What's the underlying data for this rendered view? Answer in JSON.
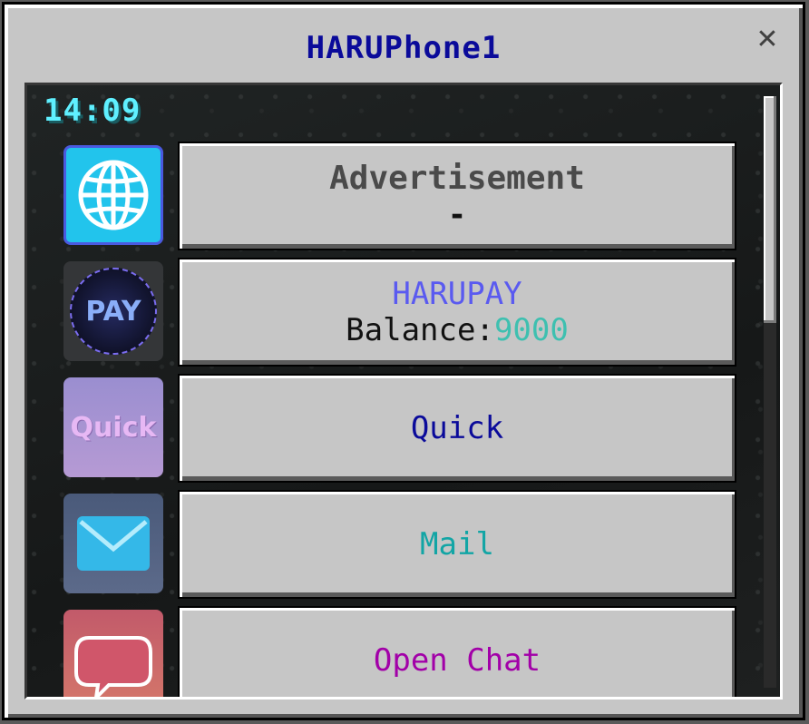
{
  "window": {
    "title": "HARUPhone1",
    "close_symbol": "✕",
    "colors": {
      "title": "#0a0a9a",
      "frame": "#c6c6c6"
    }
  },
  "screen": {
    "clock": "14:09"
  },
  "apps": [
    {
      "id": "advertisement",
      "icon": "globe-icon",
      "title": "Advertisement",
      "subtitle": "-",
      "title_color": "#4a4a4a",
      "tile_color": "#22c4ec"
    },
    {
      "id": "harupay",
      "icon": "pay-icon",
      "icon_text": "PAY",
      "title": "HARUPAY",
      "balance_label": "Balance:",
      "balance_value": "9000",
      "title_color": "#5a5af0",
      "balance_color": "#3ec0b0"
    },
    {
      "id": "quick",
      "icon": "quick-icon",
      "icon_text": "Quick",
      "title": "Quick",
      "title_color": "#0a0a9a"
    },
    {
      "id": "mail",
      "icon": "envelope-icon",
      "title": "Mail",
      "title_color": "#12a5a5"
    },
    {
      "id": "open-chat",
      "icon": "chat-bubble-icon",
      "title": "Open Chat",
      "title_color": "#a200a8"
    }
  ]
}
